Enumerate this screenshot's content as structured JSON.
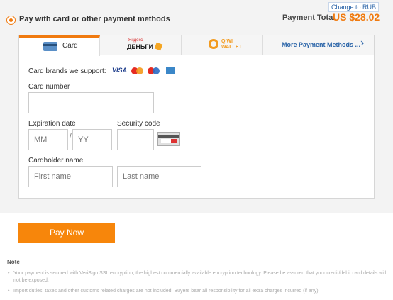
{
  "header": {
    "title": "Pay with card or other payment methods",
    "change_currency": "Change to RUB",
    "total_label": "Payment Total",
    "total_value": "US $28.02"
  },
  "tabs": {
    "card": "Card",
    "yandex_small": "Яндекс",
    "yandex_big": "ДЕНЬГИ",
    "qiwi_1": "QIWI",
    "qiwi_2": "WALLET",
    "more": "More Payment Methods ..."
  },
  "form": {
    "brands_label": "Card brands we support:",
    "brands": [
      "VISA",
      "MasterCard",
      "Maestro",
      "American Express"
    ],
    "card_number_label": "Card number",
    "card_number_value": "",
    "expiration_label": "Expiration date",
    "mm_placeholder": "MM",
    "slash": "/",
    "yy_placeholder": "YY",
    "security_label": "Security code",
    "security_value": "",
    "cardholder_label": "Cardholder name",
    "first_placeholder": "First name",
    "last_placeholder": "Last name"
  },
  "actions": {
    "pay_now": "Pay Now"
  },
  "notes": {
    "title": "Note",
    "items": [
      "Your payment is secured with VeriSign SSL encryption, the highest commercially available encryption technology. Please be assured that your credit/debit card details will not be exposed.",
      "Import duties, taxes and other customs related charges are not included. Buyers bear all responsibility for all extra charges incurred (if any)."
    ]
  },
  "colors": {
    "accent": "#f07a0f",
    "link": "#2a64a8",
    "button": "#f7860b"
  }
}
